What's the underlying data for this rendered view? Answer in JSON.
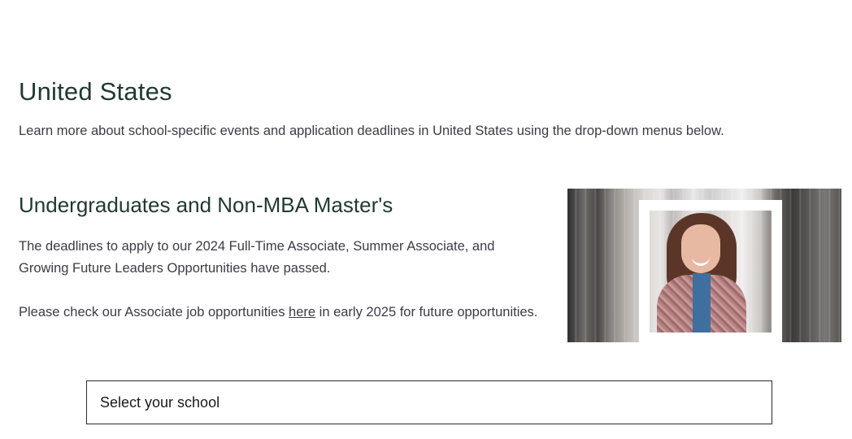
{
  "region": {
    "title": "United States",
    "intro": "Learn more about school-specific events and application deadlines in United States using the drop-down menus below."
  },
  "section": {
    "title": "Undergraduates and Non-MBA Master's",
    "paragraph1": "The deadlines to apply to our 2024 Full-Time Associate, Summer Associate, and Growing Future Leaders Opportunities have passed.",
    "paragraph2_before": "Please check our Associate job opportunities ",
    "paragraph2_link": "here",
    "paragraph2_after": " in early 2025 for future opportunities."
  },
  "school_select": {
    "label": "Select your school"
  },
  "colors": {
    "heading": "#1f3a2f",
    "body_text": "#3b3b45"
  }
}
